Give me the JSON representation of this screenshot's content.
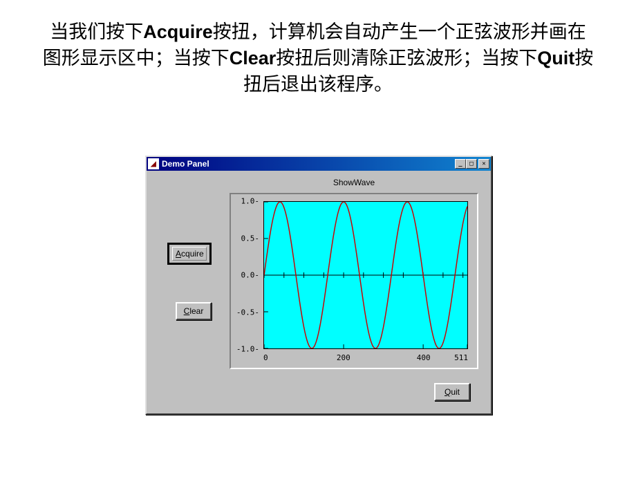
{
  "description": {
    "t1": "当我们按下",
    "b1": "Acquire",
    "t2": "按扭，计算机会自动产生一个正弦波形并画在图形显示区中；当按下",
    "b2": "Clear",
    "t3": "按扭后则清除正弦波形；当按下",
    "b3": "Quit",
    "t4": "按扭后退出该程序。"
  },
  "window": {
    "title": "Demo Panel",
    "buttons": {
      "acquire": "Acquire",
      "clear": "Clear",
      "quit": "Quit"
    }
  },
  "chart_data": {
    "type": "line",
    "title": "ShowWave",
    "xlabel": "",
    "ylabel": "",
    "xlim": [
      0,
      511
    ],
    "ylim": [
      -1.0,
      1.0
    ],
    "x_ticks": [
      0,
      200,
      400,
      511
    ],
    "y_ticks": [
      -1.0,
      -0.5,
      0.0,
      0.5,
      1.0
    ],
    "series": [
      {
        "name": "sine",
        "n_points": 512,
        "amplitude": 1.0,
        "cycles": 3.2,
        "color": "#cc0000"
      }
    ]
  }
}
